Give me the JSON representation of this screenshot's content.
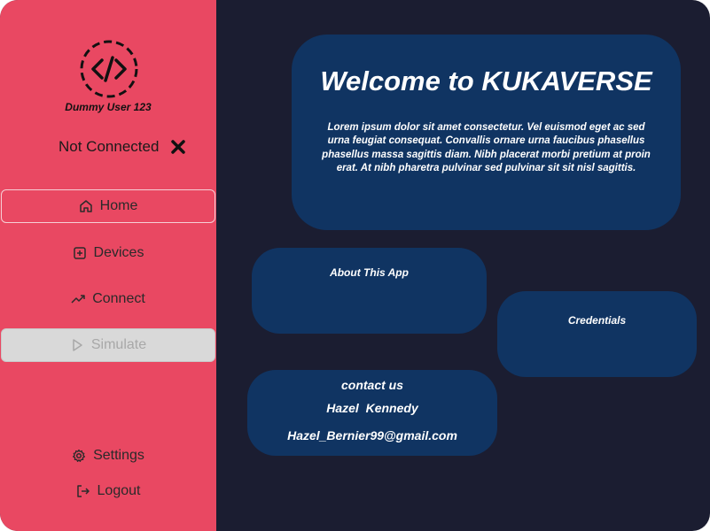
{
  "user": {
    "name": "Dummy User 123",
    "logo_glyph": "</>",
    "logo_icon": "code-icon"
  },
  "connection": {
    "status": "Not Connected",
    "status_icon": "close-icon"
  },
  "nav": {
    "items": [
      {
        "label": "Home",
        "icon": "home-icon",
        "state": "active"
      },
      {
        "label": "Devices",
        "icon": "plus-square-icon",
        "state": "normal"
      },
      {
        "label": "Connect",
        "icon": "trending-up-icon",
        "state": "normal"
      },
      {
        "label": "Simulate",
        "icon": "play-icon",
        "state": "disabled"
      }
    ],
    "bottom": [
      {
        "label": "Settings",
        "icon": "gear-icon"
      },
      {
        "label": "Logout",
        "icon": "logout-icon"
      }
    ]
  },
  "welcome": {
    "title": "Welcome to KUKAVERSE",
    "body": "Lorem ipsum dolor sit amet consectetur. Vel euismod eget ac sed urna feugiat consequat. Convallis ornare urna faucibus phasellus phasellus massa sagittis diam. Nibh placerat morbi pretium at proin erat. At nibh pharetra pulvinar sed pulvinar sit sit nisl sagittis."
  },
  "about": {
    "title": "About This App"
  },
  "credentials": {
    "title": "Credentials"
  },
  "contact": {
    "title": "contact us",
    "name": "Hazel  Kennedy",
    "email": "Hazel_Bernier99@gmail.com"
  },
  "colors": {
    "sidebar": "#e94862",
    "background": "#1b1d31",
    "card": "#103462",
    "disabled": "#d9d9d9"
  }
}
